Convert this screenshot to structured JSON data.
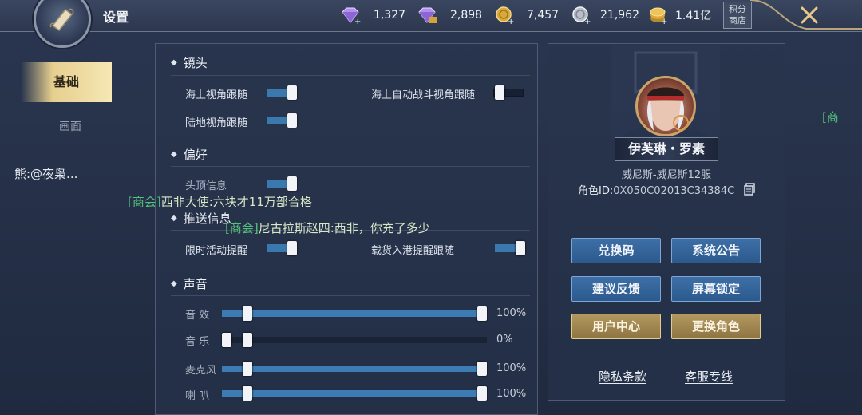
{
  "header": {
    "title": "设置",
    "currencies": [
      {
        "icon": "purple-diamond-icon",
        "value": "1,327"
      },
      {
        "icon": "bound-diamond-icon",
        "value": "2,898"
      },
      {
        "icon": "gold-coin-icon",
        "value": "7,457"
      },
      {
        "icon": "silver-coin-icon",
        "value": "21,962"
      },
      {
        "icon": "coin-stack-icon",
        "value": "1.41亿"
      }
    ],
    "shop_label_line1": "积分",
    "shop_label_line2": "商店"
  },
  "tabs": [
    {
      "label": "基础",
      "active": true
    },
    {
      "label": "画面",
      "active": false
    }
  ],
  "chat": {
    "left_text": "熊:@夜枭...",
    "line1_tag": "[商会]",
    "line1_text": "西非大使:六块才11万部合格",
    "line2_tag": "[商会]",
    "line2_text": "尼古拉斯赵四:西非，你充了多少",
    "right_tag": "[商"
  },
  "settings": {
    "camera": {
      "title": "镜头",
      "sea_follow": {
        "label": "海上视角跟随",
        "on": true
      },
      "auto_battle_follow": {
        "label": "海上自动战斗视角跟随",
        "on": false
      },
      "land_follow": {
        "label": "陆地视角跟随",
        "on": true
      }
    },
    "preference": {
      "title": "偏好",
      "head_info": {
        "label": "头顶信息",
        "on": true
      }
    },
    "push": {
      "title": "推送信息",
      "limited_event": {
        "label": "限时活动提醒",
        "on": true
      },
      "cargo_port": {
        "label": "载货入港提醒跟随",
        "on": true
      }
    },
    "sound": {
      "title": "声音",
      "sliders": [
        {
          "label": "音 效",
          "value": 100,
          "display": "100%"
        },
        {
          "label": "音 乐",
          "value": 0,
          "display": "0%"
        },
        {
          "label": "麦克风",
          "value": 100,
          "display": "100%"
        },
        {
          "label": "喇 叭",
          "value": 100,
          "display": "100%"
        }
      ]
    }
  },
  "character": {
    "name": "伊芙琳・罗素",
    "server": "威尼斯-威尼斯12服",
    "id_label": "角色ID:",
    "id_value": "0X050C02013C34384C",
    "buttons": [
      {
        "label": "兑换码",
        "style": "blue"
      },
      {
        "label": "系统公告",
        "style": "blue"
      },
      {
        "label": "建议反馈",
        "style": "blue"
      },
      {
        "label": "屏幕锁定",
        "style": "blue"
      },
      {
        "label": "用户中心",
        "style": "gold"
      },
      {
        "label": "更换角色",
        "style": "gold"
      }
    ],
    "links": {
      "privacy": "隐私条款",
      "support": "客服专线"
    }
  },
  "colors": {
    "chat_tag": "#52c27a",
    "chat_text": "#d7e8c7",
    "toggle_fill": "#3b78ae",
    "gold_button": "#a88b55",
    "blue_button": "#3466a0"
  }
}
